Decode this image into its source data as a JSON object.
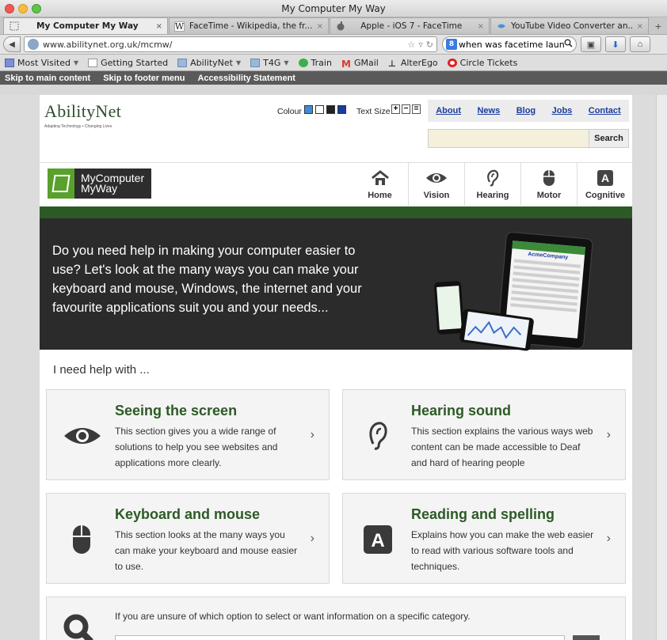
{
  "window": {
    "title": "My Computer My Way"
  },
  "tabs": [
    {
      "label": "My Computer My Way",
      "icon": "dotted-page-icon",
      "active": true
    },
    {
      "label": "FaceTime - Wikipedia, the fr...",
      "icon": "wikipedia-icon",
      "active": false
    },
    {
      "label": "Apple - iOS 7 - FaceTime",
      "icon": "apple-icon",
      "active": false
    },
    {
      "label": "YouTube Video Converter an...",
      "icon": "youtube-converter-icon",
      "active": false
    }
  ],
  "tab_close_glyph": "×",
  "tab_new_glyph": "+",
  "nav": {
    "url": "www.abilitynet.org.uk/mcmw/",
    "search_query": "when was facetime launc"
  },
  "bookmarks": [
    {
      "label": "Most Visited",
      "icon": "most-visited-icon",
      "caret": true
    },
    {
      "label": "Getting Started",
      "icon": "page-icon",
      "caret": false
    },
    {
      "label": "AbilityNet",
      "icon": "folder-icon",
      "caret": true
    },
    {
      "label": "T4G",
      "icon": "folder-icon",
      "caret": true
    },
    {
      "label": "Train",
      "icon": "train-icon",
      "caret": false
    },
    {
      "label": "GMail",
      "icon": "gmail-icon",
      "caret": false
    },
    {
      "label": "AlterEgo",
      "icon": "alterego-icon",
      "caret": false
    },
    {
      "label": "Circle Tickets",
      "icon": "circle-icon",
      "caret": false
    }
  ],
  "skip_links": [
    "Skip to main content",
    "Skip to footer menu",
    "Accessibility Statement"
  ],
  "site": {
    "logo_name": "AbilityNet",
    "logo_tagline": "Adapting Technology • Changing Lives",
    "colour_label": "Colour",
    "colour_swatches": [
      "#3b8ede",
      "#ffffff",
      "#222222",
      "#1a3c9c"
    ],
    "text_size_label": "Text Size",
    "text_size_buttons": [
      "+",
      "−",
      "="
    ],
    "top_links": [
      "About",
      "News",
      "Blog",
      "Jobs",
      "Contact"
    ],
    "search_button": "Search",
    "mcmw_logo_line1": "MyComputer",
    "mcmw_logo_line2": "MyWay",
    "main_nav": [
      {
        "label": "Home",
        "icon": "home-icon"
      },
      {
        "label": "Vision",
        "icon": "eye-icon"
      },
      {
        "label": "Hearing",
        "icon": "ear-icon"
      },
      {
        "label": "Motor",
        "icon": "mouse-icon"
      },
      {
        "label": "Cognitive",
        "icon": "letter-a-icon"
      }
    ],
    "cognitive_icon_letter": "A",
    "tablet_brand": "AcmeCompany",
    "hero_text": "Do you need help in making your computer easier to use? Let's look at the many ways you can make your keyboard and mouse, Windows, the internet and your favourite applications suit you and your needs...",
    "help_label": "I need help with ...",
    "cards": [
      {
        "title": "Seeing the screen",
        "desc": "This section gives you a wide range of solutions to help you see websites and applications more clearly.",
        "icon": "eye-icon"
      },
      {
        "title": "Hearing sound",
        "desc": "This section explains the various ways web content can be made accessible to Deaf and hard of hearing people",
        "icon": "ear-icon"
      },
      {
        "title": "Keyboard and mouse",
        "desc": "This section looks at the many ways you can make your keyboard and mouse easier to use.",
        "icon": "mouse-icon"
      },
      {
        "title": "Reading and spelling",
        "desc": "Explains how you can make the web easier to read with various software tools and techniques.",
        "icon": "letter-a-icon"
      }
    ],
    "card_arrow": "›",
    "find_text": "If you are unsure of which option to select or want information on a specific category."
  },
  "colors": {
    "brand_green": "#2c5a25",
    "link_blue": "#1a3c9c",
    "hero_bg": "#2b2b2b"
  }
}
